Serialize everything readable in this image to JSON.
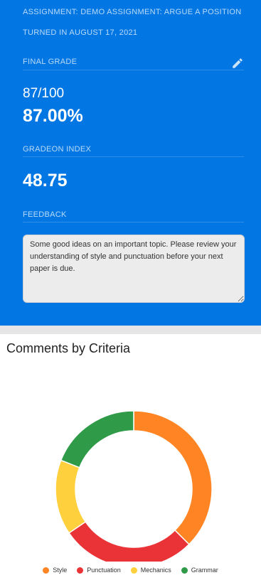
{
  "header": {
    "assignment": "ASSIGNMENT: DEMO ASSIGNMENT: ARGUE A POSITION",
    "turned_in": "TURNED IN AUGUST 17, 2021"
  },
  "grade": {
    "label": "FINAL GRADE",
    "score": "87/100",
    "percent": "87.00%",
    "edit_icon": "pencil-icon"
  },
  "gradeon": {
    "label": "GRADEON INDEX",
    "value": "48.75"
  },
  "feedback": {
    "label": "FEEDBACK",
    "text": "Some good ideas on an important topic. Please review your understanding of style and punctuation before your next paper is due."
  },
  "colors": {
    "panel": "#0277e3",
    "style": "#ff8424",
    "punctuation": "#ea3337",
    "mechanics": "#ffd03d",
    "grammar": "#2f9a48"
  },
  "chart_data": {
    "type": "pie",
    "title": "Comments by Criteria",
    "variant": "donut",
    "legend_position": "bottom",
    "categories": [
      "Style",
      "Punctuation",
      "Mechanics",
      "Grammar"
    ],
    "values": [
      37.5,
      28,
      15.5,
      19
    ],
    "colors": [
      "#ff8424",
      "#ea3337",
      "#ffd03d",
      "#2f9a48"
    ]
  }
}
